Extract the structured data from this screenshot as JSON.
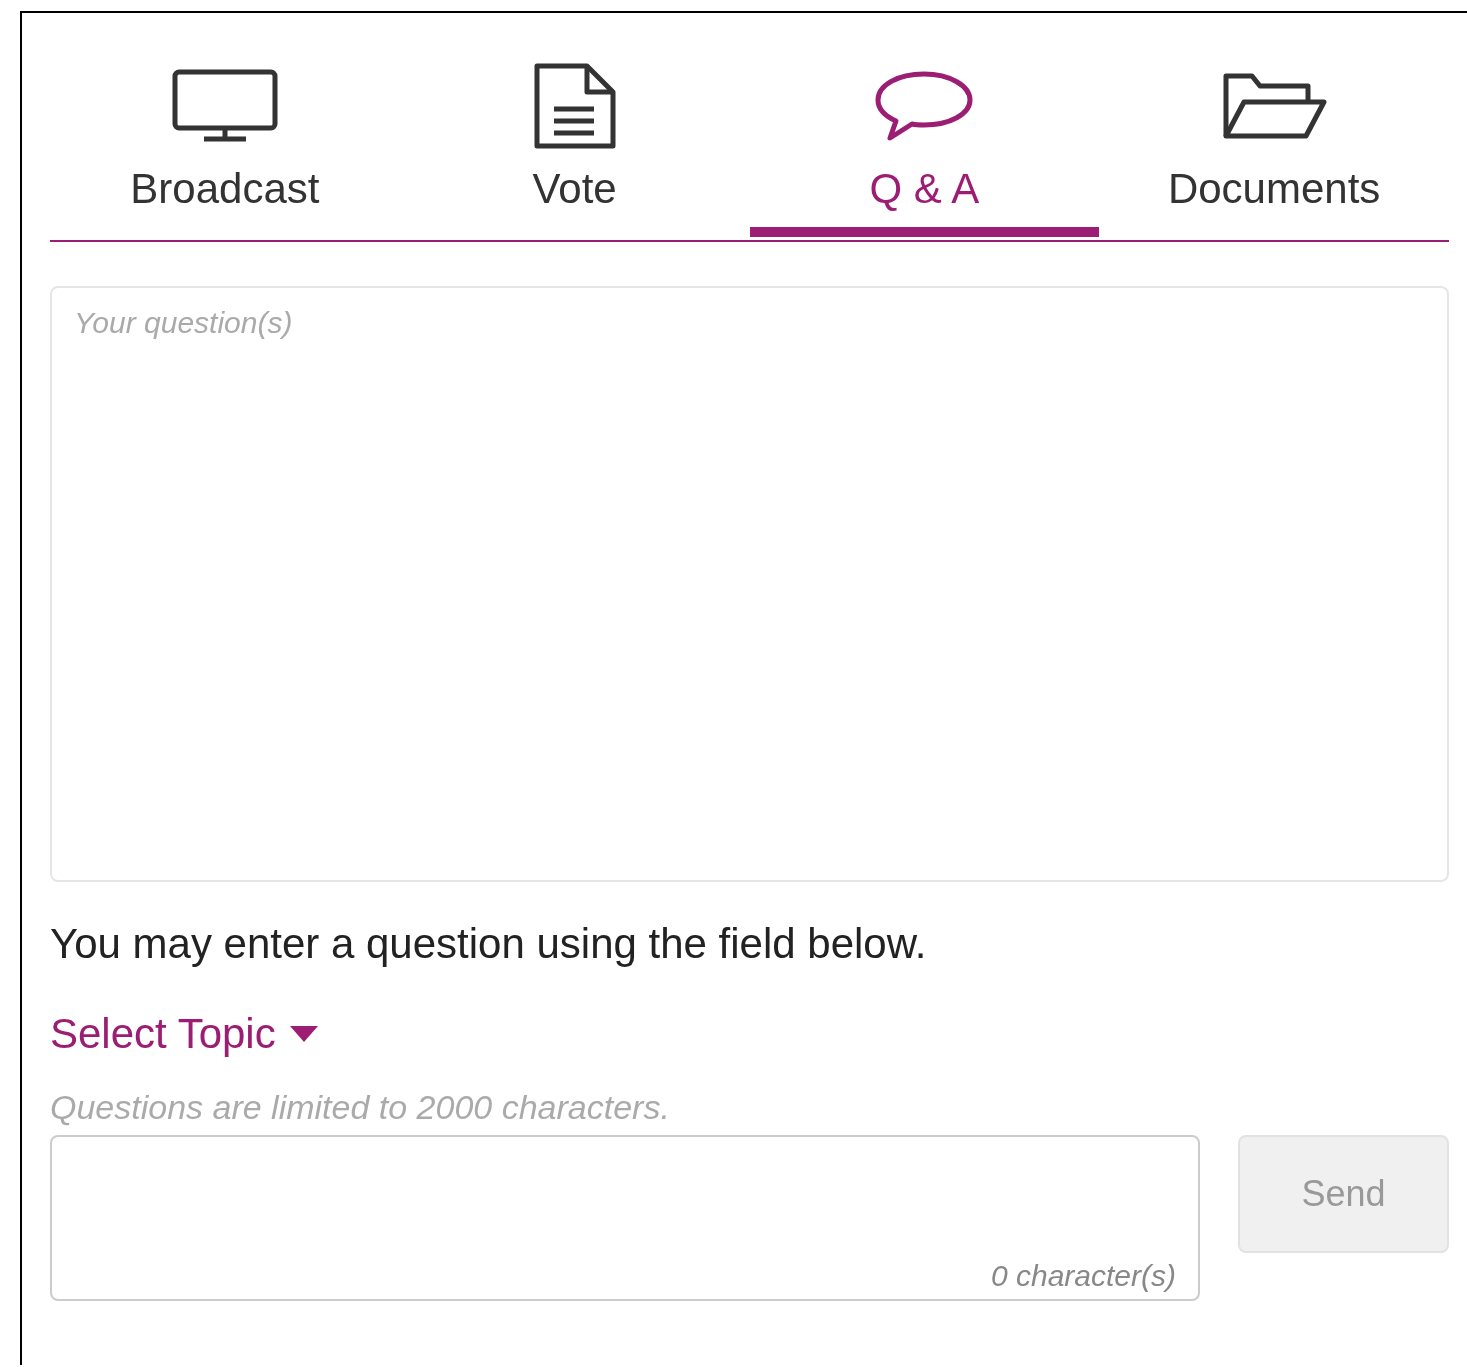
{
  "tabs": [
    {
      "label": "Broadcast",
      "kind": "monitor",
      "selected": false
    },
    {
      "label": "Vote",
      "kind": "document",
      "selected": false
    },
    {
      "label": "Q & A",
      "kind": "chat",
      "selected": true
    },
    {
      "label": "Documents",
      "kind": "folder",
      "selected": false
    }
  ],
  "question_area": {
    "placeholder": "Your question(s)"
  },
  "instructions": "You may enter a question using the field below.",
  "topic_dropdown": {
    "label": "Select Topic"
  },
  "limit_note": "Questions are limited to 2000  characters.",
  "input": {
    "counter": "0 character(s)"
  },
  "send_button": {
    "label": "Send",
    "disabled": true
  }
}
